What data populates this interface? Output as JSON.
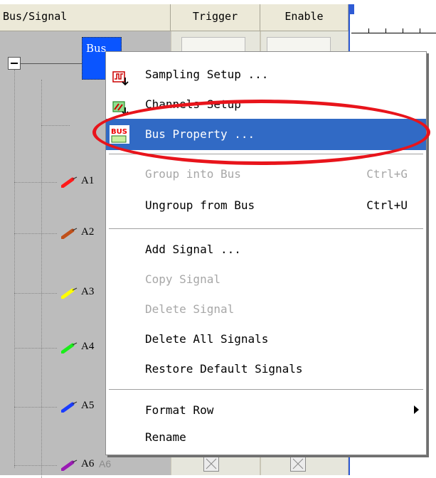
{
  "header": {
    "bus_signal": "Bus/Signal",
    "trigger": "Trigger",
    "enable": "Enable"
  },
  "tree": {
    "bus_label": "Bus",
    "signals": [
      {
        "label": "A1",
        "color": "#ff1a1a"
      },
      {
        "label": "A2",
        "color": "#c0501a"
      },
      {
        "label": "A3",
        "color": "#ffff00"
      },
      {
        "label": "A4",
        "color": "#1aee1a"
      },
      {
        "label": "A5",
        "color": "#1a3cff"
      },
      {
        "label": "A6",
        "color": "#9a1ab4",
        "alias": "A6"
      }
    ]
  },
  "menu": {
    "sampling_setup": "Sampling Setup ...",
    "channels_setup": "Channels Setup",
    "bus_property": "Bus Property ...",
    "bus_icon_text": "BUS",
    "group_into_bus": "Group into Bus",
    "group_into_bus_shortcut": "Ctrl+G",
    "ungroup_from_bus": "Ungroup from Bus",
    "ungroup_from_bus_shortcut": "Ctrl+U",
    "add_signal": "Add Signal ...",
    "copy_signal": "Copy Signal",
    "delete_signal": "Delete Signal",
    "delete_all_signals": "Delete All Signals",
    "restore_default_signals": "Restore Default Signals",
    "format_row": "Format Row",
    "rename": "Rename"
  },
  "colors": {
    "highlight": "#316ac5",
    "annotation": "#e8141b",
    "selected_node": "#0a55ff"
  }
}
